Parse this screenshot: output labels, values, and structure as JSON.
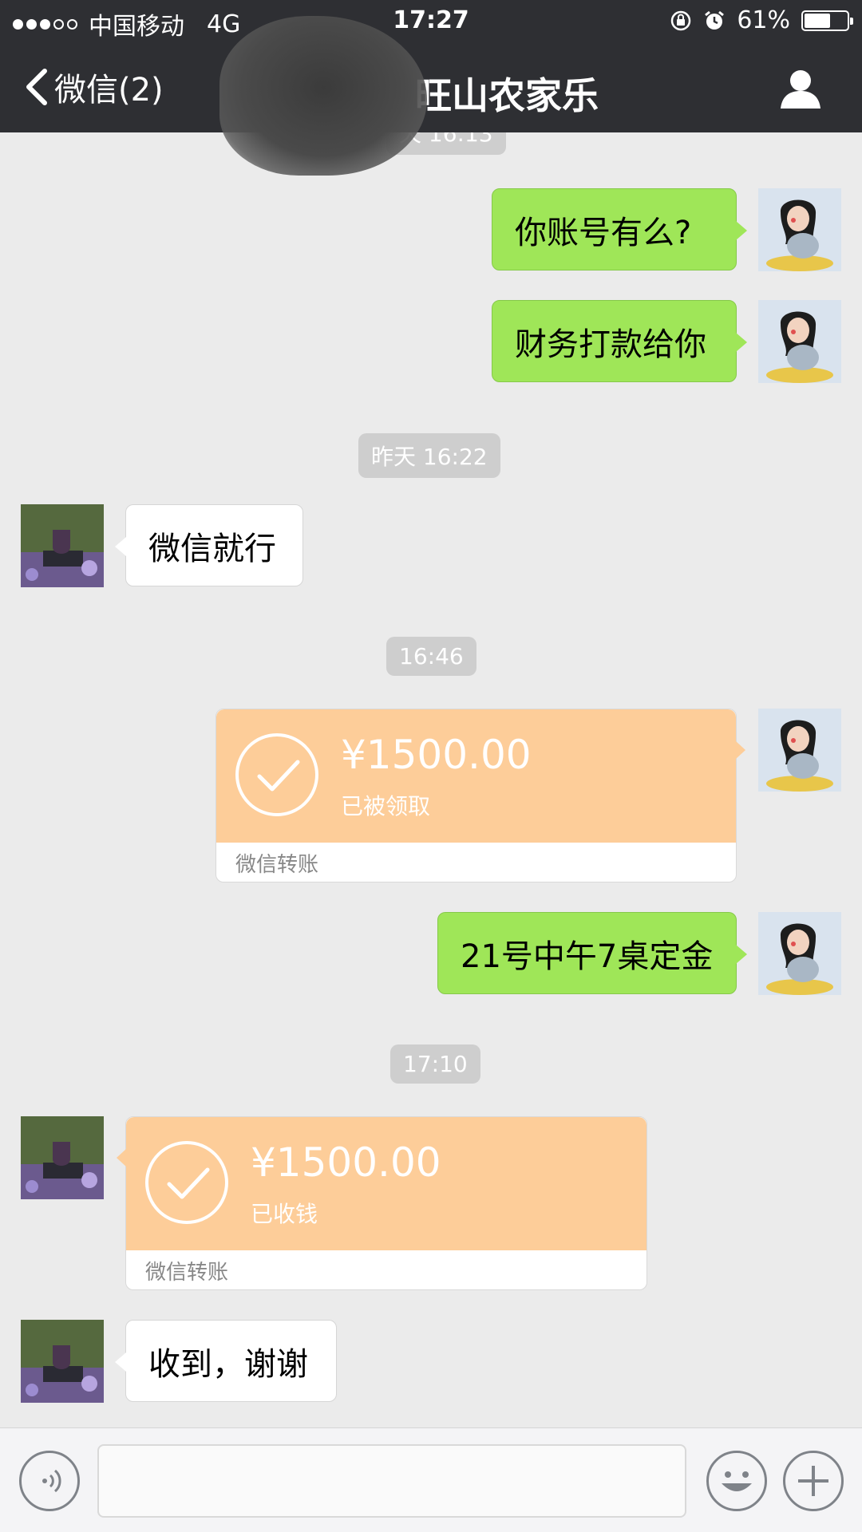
{
  "status_bar": {
    "carrier": "中国移动",
    "network": "4G",
    "time": "17:27",
    "battery": "61%",
    "battery_level": 0.61,
    "signal_bars_full": 3,
    "signal_bars_total": 5
  },
  "nav": {
    "back_label": "微信(2)",
    "title": "旺山农家乐"
  },
  "timestamps": {
    "top_partial": "天 16:13",
    "t1": "昨天 16:22",
    "t2": "16:46",
    "t3": "17:10"
  },
  "messages": {
    "m1": "你账号有么?",
    "m2": "财务打款给你",
    "m3": "微信就行",
    "m4": "21号中午7桌定金",
    "m5": "收到，谢谢"
  },
  "transfers": {
    "sent": {
      "amount": "¥1500.00",
      "status": "已被领取",
      "label": "微信转账"
    },
    "received": {
      "amount": "¥1500.00",
      "status": "已收钱",
      "label": "微信转账"
    }
  },
  "colors": {
    "nav_bg": "#2e2f33",
    "chat_bg": "#ebebeb",
    "my_bubble": "#9fe658",
    "transfer_bg": "#fdcd99"
  }
}
